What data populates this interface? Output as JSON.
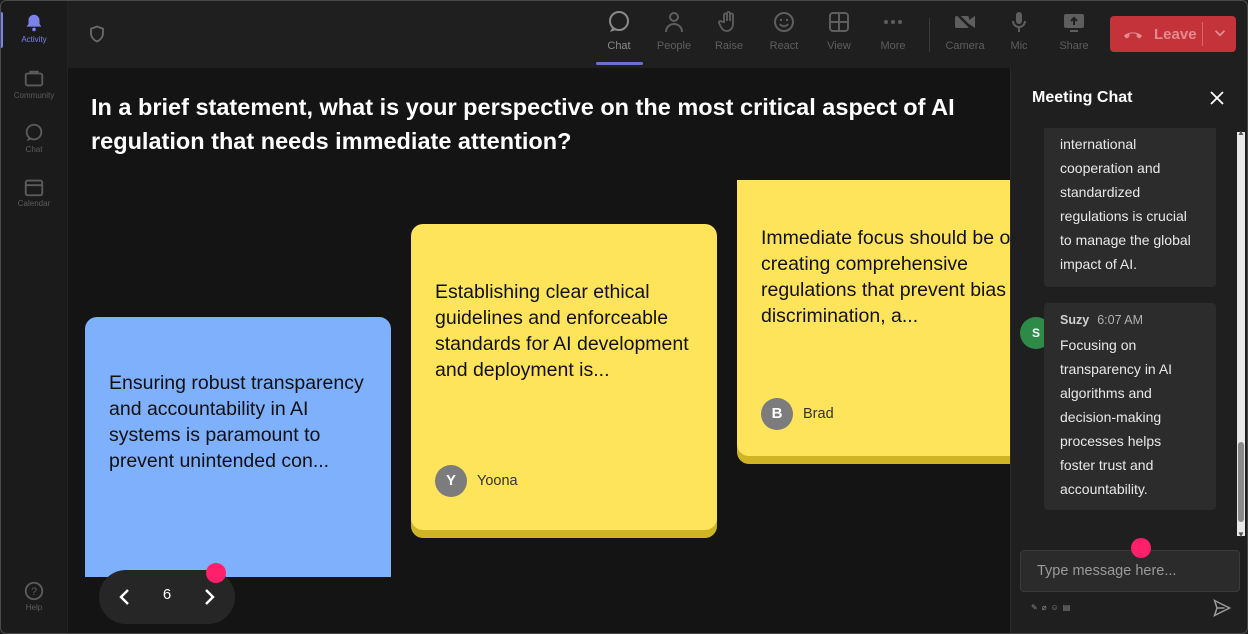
{
  "rail": {
    "items": [
      {
        "label": "Activity",
        "icon": "bell-icon"
      },
      {
        "label": "Community",
        "icon": "community-icon"
      },
      {
        "label": "Chat",
        "icon": "chat-icon"
      },
      {
        "label": "Calendar",
        "icon": "calendar-icon"
      }
    ],
    "help": {
      "label": "Help",
      "icon": "help-icon"
    }
  },
  "toolbar": {
    "chat": "Chat",
    "people": "People",
    "raise": "Raise",
    "react": "React",
    "view": "View",
    "more": "More",
    "camera": "Camera",
    "mic": "Mic",
    "share": "Share",
    "leave": "Leave"
  },
  "colors": {
    "leave": "#c4333a",
    "note_blue": "#7eb0fc",
    "note_yellow": "#fde45a",
    "accent": "#7b83eb",
    "dot": "#ff1f6a"
  },
  "question": "In a brief statement, what is your perspective on the most critical aspect of AI regulation that needs immediate attention?",
  "notes": [
    {
      "text": "Ensuring robust transparency and accountability in AI systems is paramount to prevent unintended con...",
      "author": "",
      "initial": ""
    },
    {
      "text": "Establishing clear ethical guidelines and enforceable standards for AI development and deployment is...",
      "author": "Yoona",
      "initial": "Y"
    },
    {
      "text": "Immediate focus should be on creating comprehensive regulations that prevent bias discrimination, a...",
      "author": "Brad",
      "initial": "B"
    }
  ],
  "pager": {
    "page": "6"
  },
  "chat": {
    "title": "Meeting Chat",
    "messages": [
      {
        "text": "international cooperation and standardized regulations is crucial to manage the global impact of AI."
      },
      {
        "sender": "Suzy",
        "initial": "S",
        "time": "6:07 AM",
        "text": "Focusing on transparency in AI algorithms and decision-making processes helps foster trust and accountability."
      }
    ],
    "input_placeholder": "Type message here..."
  }
}
